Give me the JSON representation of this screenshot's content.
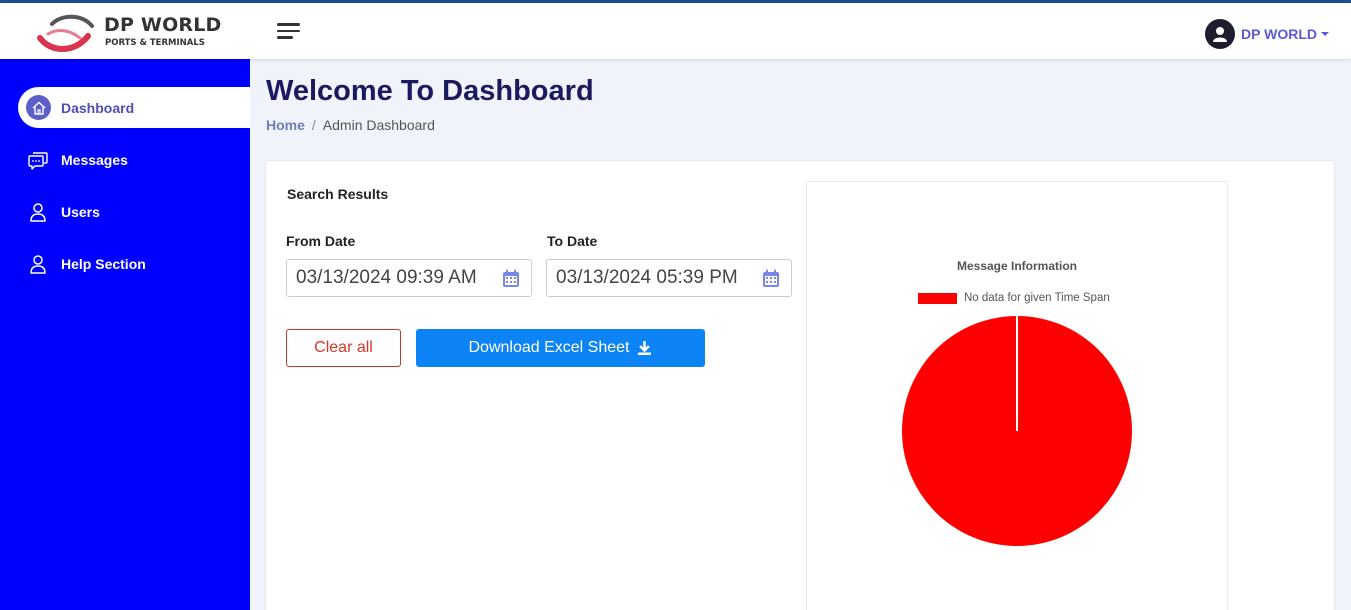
{
  "header": {
    "logo_title": "DP WORLD",
    "logo_subtitle": "PORTS & TERMINALS",
    "menu_icon": "hamburger-icon",
    "user_name": "DP WORLD",
    "user_icon": "user-avatar-icon"
  },
  "sidebar": {
    "items": [
      {
        "label": "Dashboard",
        "icon": "home-icon",
        "active": true
      },
      {
        "label": "Messages",
        "icon": "chat-icon",
        "active": false
      },
      {
        "label": "Users",
        "icon": "user-icon",
        "active": false
      },
      {
        "label": "Help Section",
        "icon": "user-icon",
        "active": false
      }
    ]
  },
  "page": {
    "title": "Welcome To Dashboard",
    "breadcrumb": {
      "home": "Home",
      "separator": "/",
      "current": "Admin Dashboard"
    }
  },
  "search": {
    "title": "Search Results",
    "from_label": "From Date",
    "from_value": "03/13/2024 09:39 AM",
    "to_label": "To Date",
    "to_value": "03/13/2024 05:39 PM",
    "clear_label": "Clear all",
    "download_label": "Download Excel Sheet"
  },
  "colors": {
    "sidebar_bg": "#0000ff",
    "accent": "#5a5ad6",
    "download_button": "#0d84f5",
    "clear_button": "#d9342b",
    "pie_slice": "#ff0000"
  },
  "chart_data": {
    "type": "pie",
    "title": "Message Information",
    "legend": "top",
    "categories": [
      "No data for given Time Span"
    ],
    "values": [
      1
    ],
    "colors": [
      "#ff0000"
    ]
  }
}
